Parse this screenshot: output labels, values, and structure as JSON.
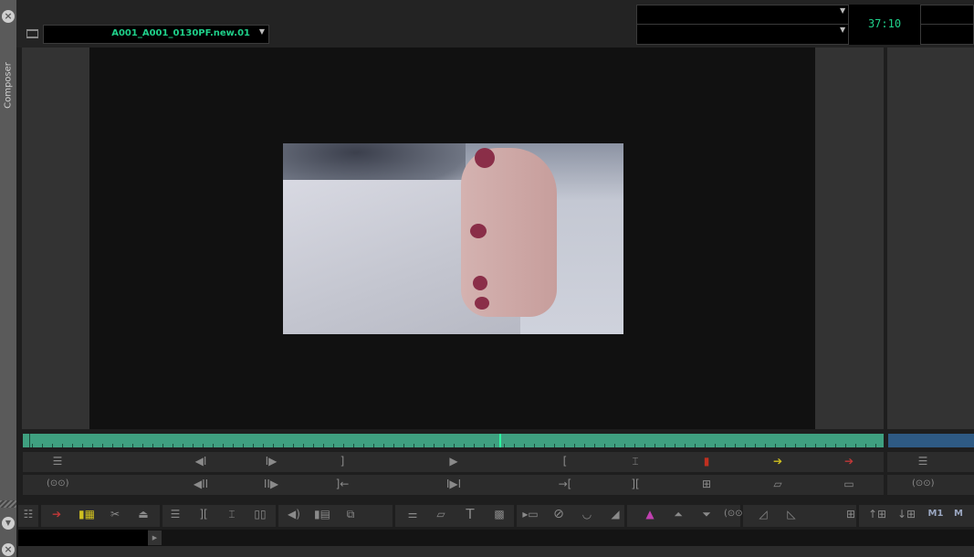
{
  "window": {
    "panel_tab": "Composer"
  },
  "source": {
    "clip_name": "A001_A001_0130PF.new.01"
  },
  "record": {
    "timecode": "37:10"
  },
  "colors": {
    "accent_green": "#1fd08a",
    "timeline": "#3fa080",
    "timeline_record": "#2e5a84"
  },
  "buttons_row1": [
    "clip-list",
    "step-back-one",
    "step-forward-one",
    "mark-out",
    "play",
    "mark-in",
    "mark-clip",
    "marker",
    "splice-in",
    "overwrite",
    "clip-list-record"
  ],
  "buttons_row2": [
    "toggle-source-record",
    "step-back-ten",
    "step-forward-ten",
    "go-to-out",
    "go-to-end",
    "go-to-in",
    "clear-marks",
    "quad-split",
    "trim",
    "match-frame",
    "toggle-record"
  ],
  "toolbar": {
    "m1": "M1",
    "m2": "M"
  }
}
